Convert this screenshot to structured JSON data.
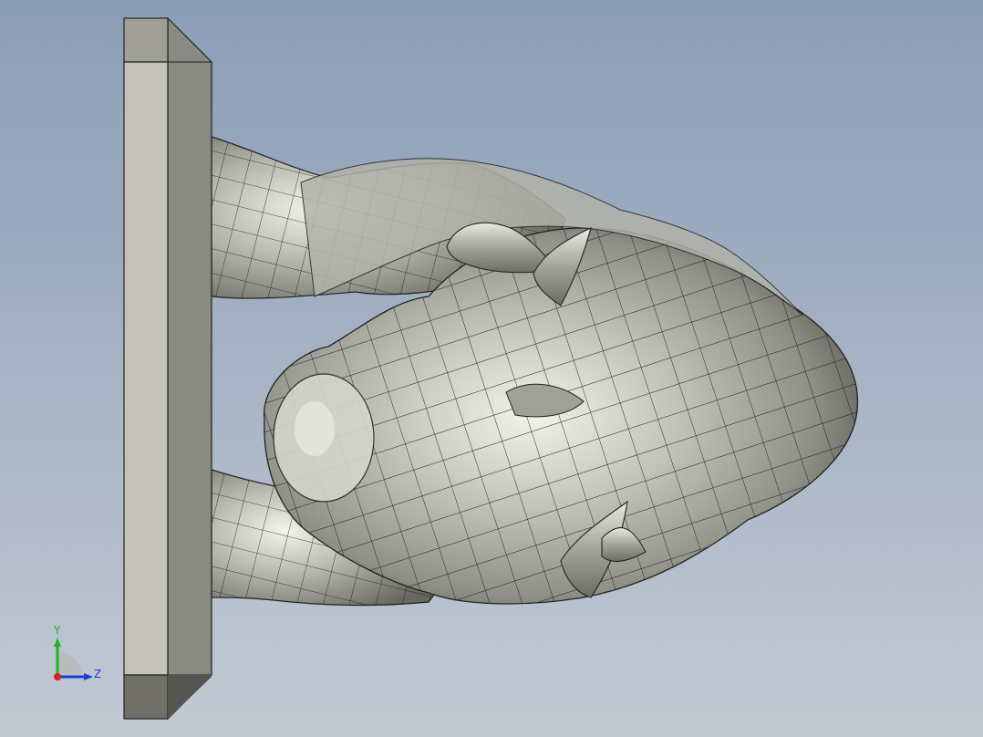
{
  "viewport": {
    "background_top": "#8b9db6",
    "background_bottom": "#c2c9d3",
    "model_color": "#b7b8ad",
    "plate_color": "#c3c3b9"
  },
  "triad": {
    "y_label": "Y",
    "z_label": "Z",
    "y_color": "#1fb31f",
    "z_color": "#1f3fd6",
    "x_color": "#d62020"
  },
  "model": {
    "icon": "bull-head-mesh-icon",
    "plate_icon": "mounting-plate-icon"
  }
}
